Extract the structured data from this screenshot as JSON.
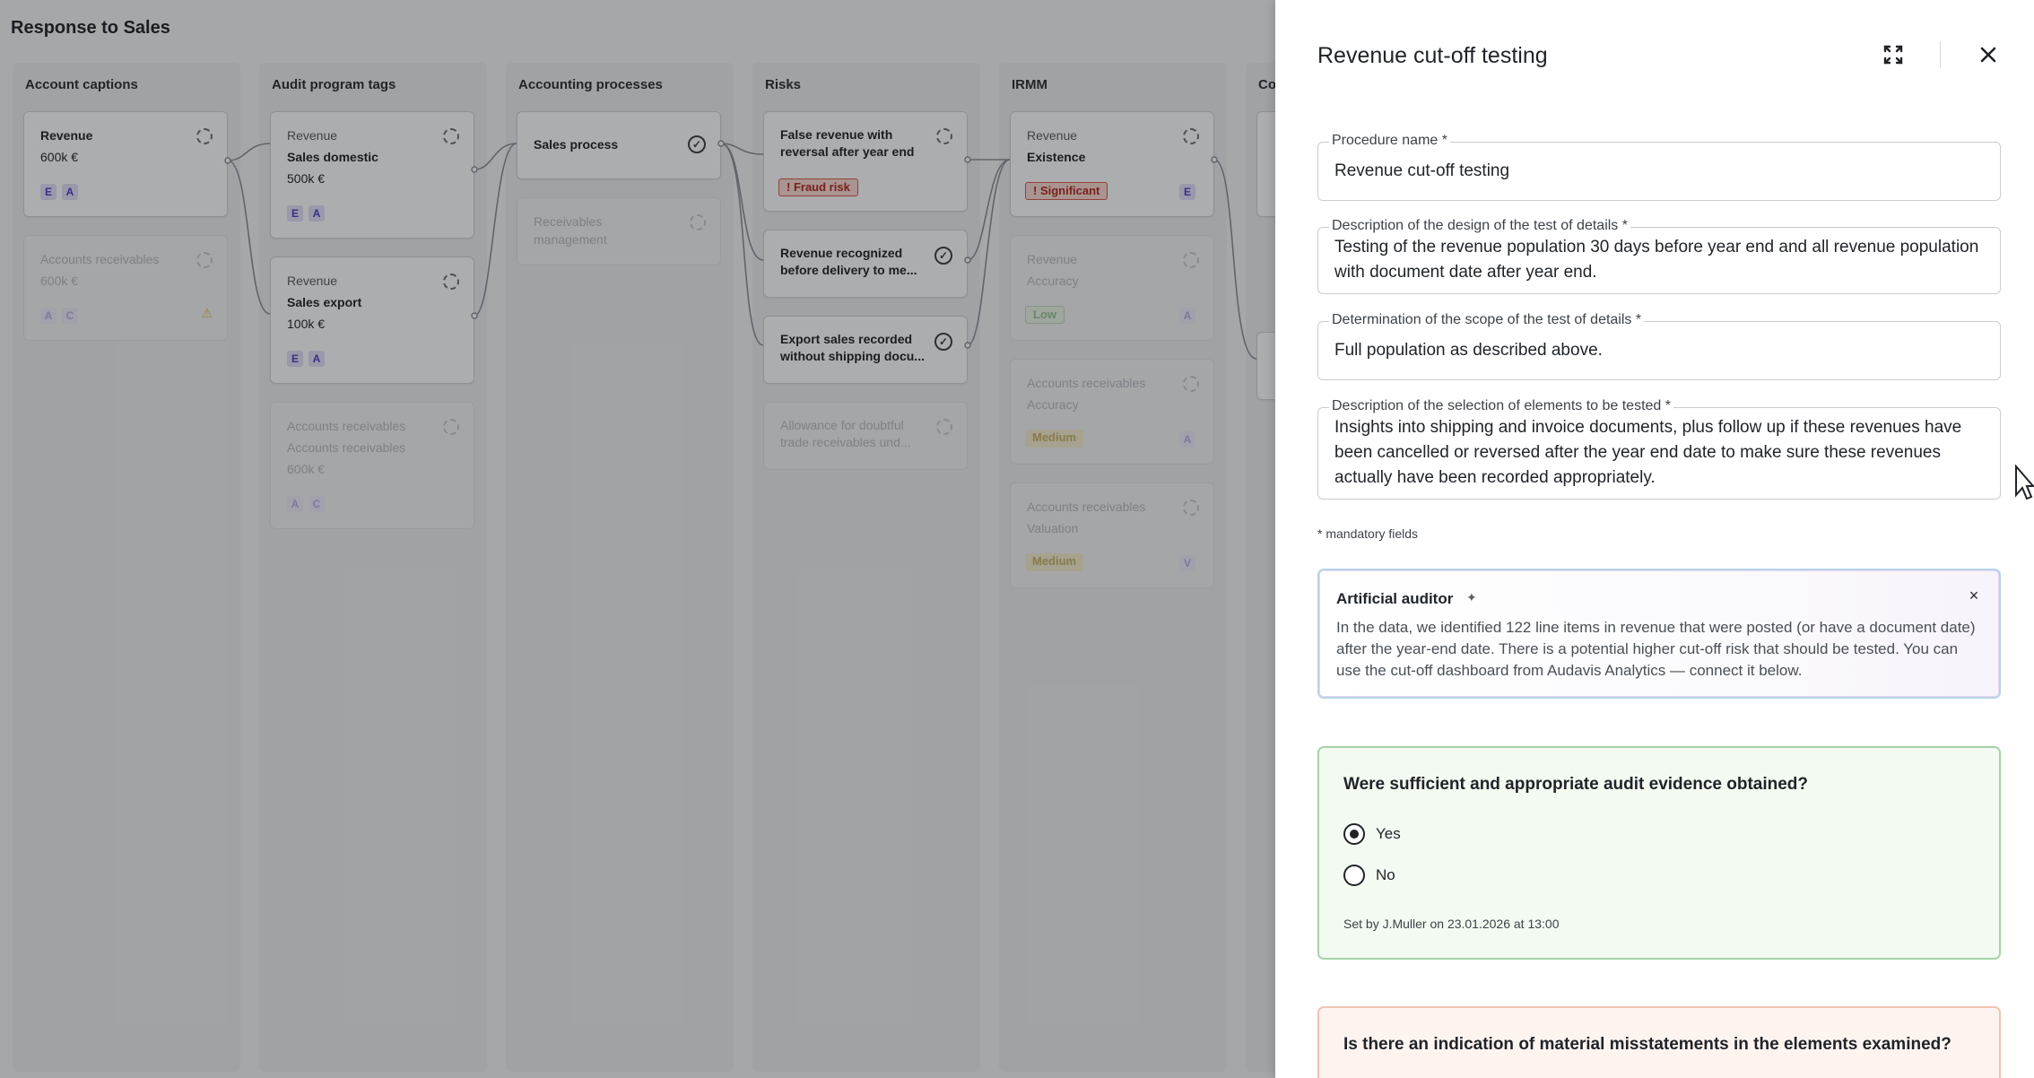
{
  "board": {
    "title": "Response to Sales",
    "columns": [
      {
        "header": "Account captions",
        "cards": [
          {
            "line1": "Revenue",
            "line2": "600k €",
            "tags": [
              "E",
              "A"
            ]
          },
          {
            "line1": "Accounts receivables",
            "line2": "600k €",
            "tags": [
              "A",
              "C"
            ],
            "warning": "⚠"
          }
        ]
      },
      {
        "header": "Audit program tags",
        "cards": [
          {
            "line1": "Revenue",
            "line2": "Sales domestic",
            "line3": "500k €",
            "tags": [
              "E",
              "A"
            ]
          },
          {
            "line1": "Revenue",
            "line2": "Sales export",
            "line3": "100k €",
            "tags": [
              "E",
              "A"
            ]
          },
          {
            "line1": "Accounts receivables",
            "line2": "Accounts receivables",
            "line3": "600k €",
            "tags": [
              "A",
              "C"
            ]
          }
        ]
      },
      {
        "header": "Accounting processes",
        "cards": [
          {
            "line1": "Sales process"
          },
          {
            "line1": "Receivables",
            "line2": "management"
          }
        ]
      },
      {
        "header": "Risks",
        "cards": [
          {
            "text": "False revenue with reversal after year end",
            "pill": "! Fraud risk"
          },
          {
            "text": "Revenue recognized before delivery to me..."
          },
          {
            "text": "Export sales recorded without shipping docu..."
          },
          {
            "text": "Allowance for doubtful trade receivables und..."
          }
        ]
      },
      {
        "header": "IRMM",
        "cards": [
          {
            "line1": "Revenue",
            "line2": "Existence",
            "pill": "! Significant",
            "tag": "E"
          },
          {
            "line1": "Revenue",
            "line2": "Accuracy",
            "pill": "Low",
            "tag": "A"
          },
          {
            "line1": "Accounts receivables",
            "line2": "Accuracy",
            "pill": "Medium",
            "tag": "A"
          },
          {
            "line1": "Accounts receivables",
            "line2": "Valuation",
            "pill": "Medium",
            "tag": "V"
          }
        ]
      },
      {
        "header": "Co"
      }
    ]
  },
  "drawer": {
    "title": "Revenue cut-off testing",
    "fields": [
      {
        "label": "Procedure name *",
        "value": "Revenue cut-off testing"
      },
      {
        "label": "Description of the design of the test of details *",
        "value": "Testing of the revenue population 30 days before year end and all revenue population with document date after year end."
      },
      {
        "label": "Determination of the scope of the test of details *",
        "value": "Full population as described above."
      },
      {
        "label": "Description of the selection of elements to be tested *",
        "value": "Insights into shipping and invoice documents, plus follow up if these revenues have been cancelled or reversed after the year end date to make sure these revenues actually have been recorded appropriately."
      }
    ],
    "mandatory_note": "* mandatory fields",
    "ai": {
      "title": "Artificial auditor",
      "text": "In the data, we identified 122 line items in revenue that were posted (or have a document date) after the year-end date. There is a potential higher cut-off risk that should be tested. You can use the cut-off dashboard from Audavis Analytics — connect it below."
    },
    "question1": {
      "text": "Were sufficient and appropriate audit evidence obtained?",
      "options": [
        "Yes",
        "No"
      ],
      "selected": "Yes",
      "set_by": "Set by J.Muller on 23.01.2026 at 13:00"
    },
    "question2": {
      "text": "Is there an indication of material misstatements in the elements examined?"
    }
  },
  "colors": {
    "accent_tag": "#4a3fbf",
    "fraud_red": "#b02a1e",
    "success_green": "#a6d4a6",
    "warning_orange": "#efc3b1"
  },
  "icons": [
    "expand-icon",
    "close-icon",
    "sparkle-icon",
    "pending-circle-icon",
    "check-circle-icon",
    "warning-icon",
    "mouse-cursor-icon"
  ]
}
